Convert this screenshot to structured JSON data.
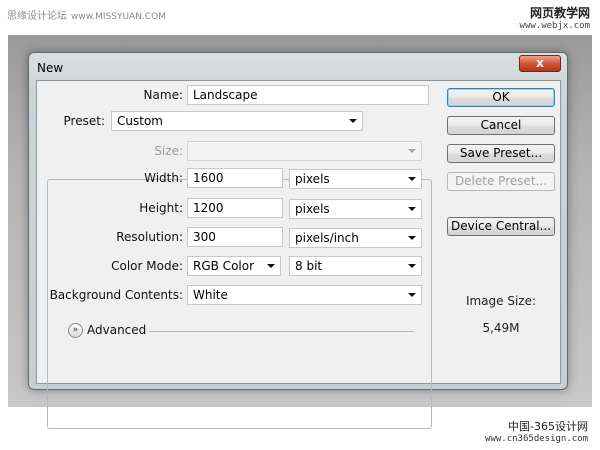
{
  "watermarks": {
    "top_left": "思缘设计论坛",
    "top_left_url": "www.MISSYUAN.COM",
    "top_right": "网页教学网",
    "top_right_url": "www.webjx.com",
    "bottom_right": "中国-365设计网",
    "bottom_right_url": "www.cn365design.com"
  },
  "dialog": {
    "title": "New",
    "close_symbol": "x",
    "name_label": "Name:",
    "name_value": "Landscape",
    "preset_label": "Preset:",
    "preset_value": "Custom",
    "size_label": "Size:",
    "size_value": "",
    "width_label": "Width:",
    "width_value": "1600",
    "width_unit": "pixels",
    "height_label": "Height:",
    "height_value": "1200",
    "height_unit": "pixels",
    "resolution_label": "Resolution:",
    "resolution_value": "300",
    "resolution_unit": "pixels/inch",
    "color_mode_label": "Color Mode:",
    "color_mode_value": "RGB Color",
    "bit_depth_value": "8 bit",
    "background_label": "Background Contents:",
    "background_value": "White",
    "advanced_label": "Advanced",
    "advanced_icon": "double-chevron-down-icon",
    "buttons": {
      "ok": "OK",
      "cancel": "Cancel",
      "save_preset": "Save Preset...",
      "delete_preset": "Delete Preset...",
      "device_central": "Device Central..."
    },
    "image_size_label": "Image Size:",
    "image_size_value": "5,49M"
  }
}
